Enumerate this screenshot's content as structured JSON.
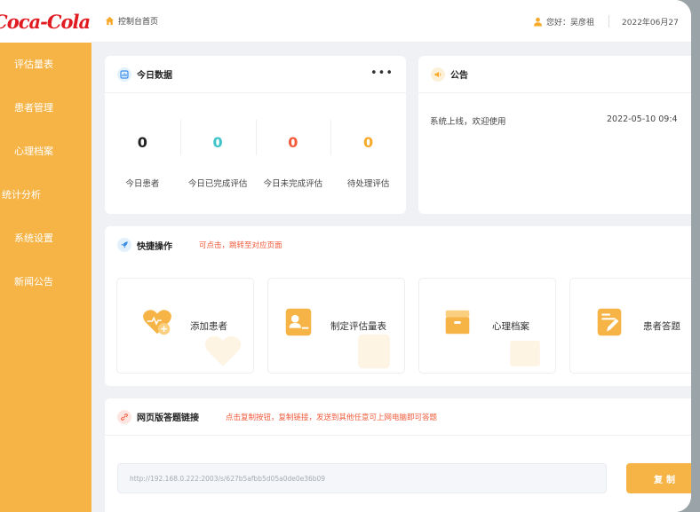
{
  "brand": {
    "logo_text": "Coca-Cola",
    "color": "#e01b22"
  },
  "sidebar": {
    "accent": "#f7b446",
    "items": [
      {
        "label": "评估量表"
      },
      {
        "label": "患者管理"
      },
      {
        "label": "心理档案"
      },
      {
        "label": "统计分析"
      },
      {
        "label": "系统设置"
      },
      {
        "label": "新闻公告"
      }
    ]
  },
  "header": {
    "breadcrumb": "控制台首页",
    "greeting": "您好：",
    "username": "吴彦祖",
    "date": "2022年06月27"
  },
  "today": {
    "title": "今日数据",
    "more": "•••",
    "stats": [
      {
        "value": "0",
        "label": "今日患者",
        "color": "#222222"
      },
      {
        "value": "0",
        "label": "今日已完成评估",
        "color": "#3cc4c9"
      },
      {
        "value": "0",
        "label": "今日未完成评估",
        "color": "#f25a3a"
      },
      {
        "value": "0",
        "label": "待处理评估",
        "color": "#f7a92a"
      }
    ]
  },
  "notice": {
    "title": "公告",
    "items": [
      {
        "text": "系统上线，欢迎使用",
        "date": "2022-05-10 09:4"
      }
    ]
  },
  "quick": {
    "title": "快捷操作",
    "hint": "可点击，跳转至对应页面",
    "items": [
      {
        "label": "添加患者",
        "icon": "heart-plus-icon"
      },
      {
        "label": "制定评估量表",
        "icon": "person-card-icon"
      },
      {
        "label": "心理档案",
        "icon": "archive-box-icon"
      },
      {
        "label": "患者答题",
        "icon": "document-edit-icon"
      }
    ]
  },
  "link": {
    "title": "网页版答题链接",
    "hint": "点击复制按钮，复制链接，发送到其他任意可上网电脑即可答题",
    "url": "http://192.168.0.222:2003/s/627b5afbb5d05a0de0e36b09",
    "copy_label": "复制"
  }
}
